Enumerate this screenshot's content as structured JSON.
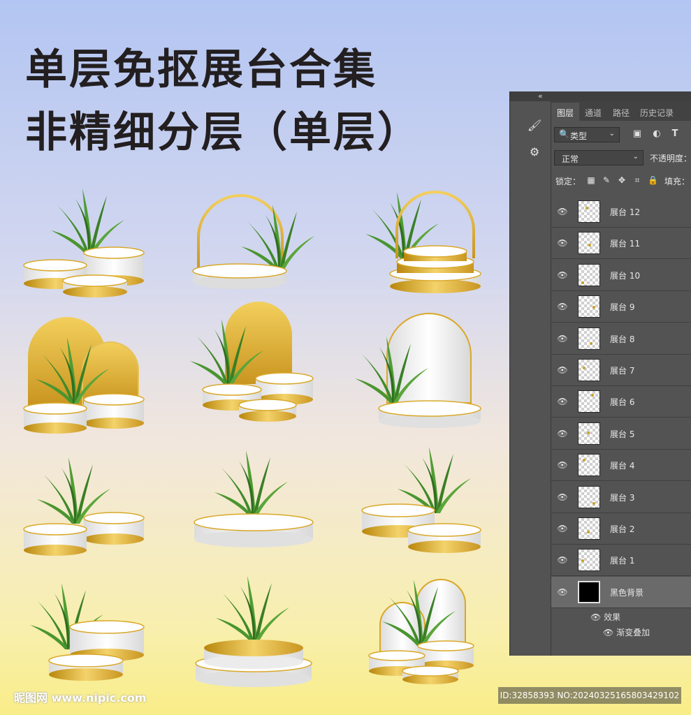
{
  "titles": {
    "line1": "单层免抠展台合集",
    "line2": "非精细分层（单层）"
  },
  "products": [
    {
      "name": "product-1",
      "variant": "three-pedestals-plant"
    },
    {
      "name": "product-2",
      "variant": "gold-arch-single-disc"
    },
    {
      "name": "product-3",
      "variant": "gold-arch-stacked-steps"
    },
    {
      "name": "product-4",
      "variant": "two-gold-arches-pedestals"
    },
    {
      "name": "product-5",
      "variant": "gold-arch-three-pedestals"
    },
    {
      "name": "product-6",
      "variant": "white-arch-single-disc"
    },
    {
      "name": "product-7",
      "variant": "two-pedestals-plant"
    },
    {
      "name": "product-8",
      "variant": "wide-disc-plant"
    },
    {
      "name": "product-9",
      "variant": "two-discs-plant"
    },
    {
      "name": "product-10",
      "variant": "two-pedestals-plant-right"
    },
    {
      "name": "product-11",
      "variant": "gold-bowl-disc"
    },
    {
      "name": "product-12",
      "variant": "white-arches-three-pedestals"
    }
  ],
  "panel": {
    "collapse_glyph": "«",
    "tabs": [
      "图层",
      "通道",
      "路径",
      "历史记录"
    ],
    "filter_kind": "类型",
    "blend_mode": "正常",
    "opacity_label": "不透明度：",
    "lock_label": "锁定：",
    "fill_label": "填充：",
    "layers": [
      {
        "label": "展台 12"
      },
      {
        "label": "展台 11"
      },
      {
        "label": "展台 10"
      },
      {
        "label": "展台 9"
      },
      {
        "label": "展台 8"
      },
      {
        "label": "展台 7"
      },
      {
        "label": "展台 6"
      },
      {
        "label": "展台 5"
      },
      {
        "label": "展台 4"
      },
      {
        "label": "展台 3"
      },
      {
        "label": "展台 2"
      },
      {
        "label": "展台 1"
      },
      {
        "label": "黑色背景"
      }
    ],
    "effects_label": "效果",
    "effect_item": "渐变叠加"
  },
  "watermark": {
    "site": "昵图网 www.nipic.com",
    "id_text": "ID:32858393 NO:20240325165803429102"
  },
  "colors": {
    "gold": "#d9a829",
    "leaf": "#3f8a2a",
    "panel_bg": "#535353"
  }
}
